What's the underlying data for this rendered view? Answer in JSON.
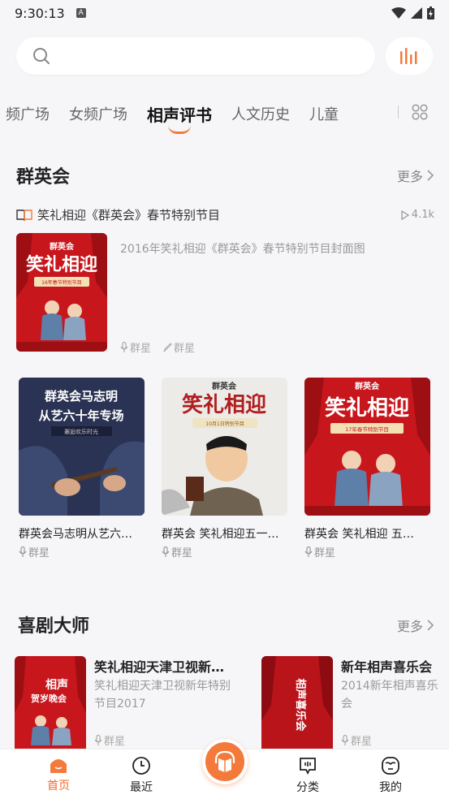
{
  "status": {
    "time": "9:30:13",
    "badge": "A"
  },
  "search": {
    "placeholder": ""
  },
  "tabs": [
    "频广场",
    "女频广场",
    "相声评书",
    "人文历史",
    "儿童"
  ],
  "active_tab": "相声评书",
  "section1": {
    "title": "群英会",
    "more": "更多",
    "featured": {
      "title": "笑礼相迎《群英会》春节特别节目",
      "plays": "4.1k",
      "description": "2016年笑礼相迎《群英会》春节特别节目封面图",
      "narrator": "群星",
      "author": "群星",
      "cover_top": "群英会",
      "cover_main": "笑礼相迎",
      "cover_sub": "16年春节特别节目"
    },
    "cards": [
      {
        "name": "群英会马志明从艺六…",
        "author": "群星",
        "cover_line1": "群英会马志明",
        "cover_line2": "从艺六十年专场",
        "cover_tag": "邂逅欢乐时光"
      },
      {
        "name": "群英会 笑礼相迎五一…",
        "author": "群星",
        "cover_top": "群英会",
        "cover_main": "笑礼相迎",
        "cover_sub": "10月1日特别节目"
      },
      {
        "name": "群英会 笑礼相迎 五…",
        "author": "群星",
        "cover_top": "群英会",
        "cover_main": "笑礼相迎",
        "cover_sub": "17年春节特别节目"
      }
    ]
  },
  "section2": {
    "title": "喜剧大师",
    "more": "更多",
    "items": [
      {
        "title": "笑礼相迎天津卫视新…",
        "desc_line1": "笑礼相迎天津卫视新年特别",
        "desc_line2": "节目2017",
        "author": "群星",
        "cover_text1": "相声",
        "cover_text2": "贺岁晚会"
      },
      {
        "title": "新年相声喜乐会",
        "desc_line1": "2014新年相声喜乐会",
        "author": "群星",
        "cover_text": "相声喜乐会"
      }
    ]
  },
  "nav": {
    "home": "首页",
    "recent": "最近",
    "category": "分类",
    "mine": "我的"
  },
  "colors": {
    "accent": "#f47a3c",
    "poster_red": "#c8161d"
  }
}
